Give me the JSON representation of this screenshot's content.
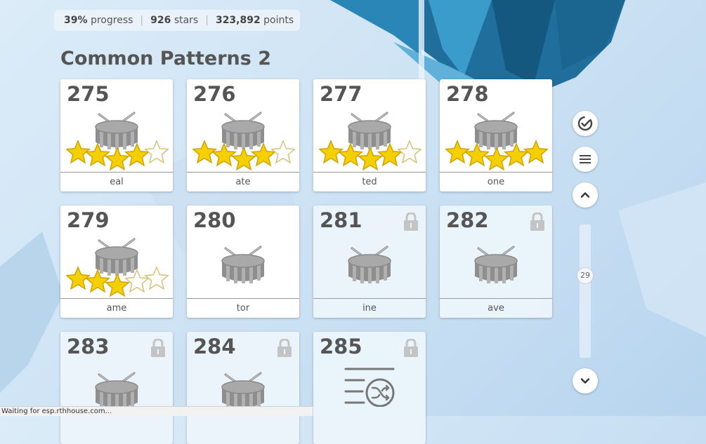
{
  "stats": {
    "progress_value": "39%",
    "progress_label": "progress",
    "stars_value": "926",
    "stars_label": "stars",
    "points_value": "323,892",
    "points_label": "points"
  },
  "section_title": "Common Patterns 2",
  "levels": [
    {
      "number": "275",
      "label": "eal",
      "stars": 4,
      "locked": false
    },
    {
      "number": "276",
      "label": "ate",
      "stars": 4,
      "locked": false
    },
    {
      "number": "277",
      "label": "ted",
      "stars": 4,
      "locked": false
    },
    {
      "number": "278",
      "label": "one",
      "stars": 5,
      "locked": false
    },
    {
      "number": "279",
      "label": "ame",
      "stars": 3,
      "locked": false
    },
    {
      "number": "280",
      "label": "tor",
      "stars": 0,
      "locked": false
    },
    {
      "number": "281",
      "label": "ine",
      "stars": 0,
      "locked": true
    },
    {
      "number": "282",
      "label": "ave",
      "stars": 0,
      "locked": true
    },
    {
      "number": "283",
      "label": "",
      "stars": 0,
      "locked": true
    },
    {
      "number": "284",
      "label": "",
      "stars": 0,
      "locked": true
    },
    {
      "number": "285",
      "label": "",
      "stars": 0,
      "locked": true,
      "icon": "shuffle-list-icon"
    }
  ],
  "sidebar": {
    "check_icon": "check-circle-icon",
    "menu_icon": "menu-icon",
    "up_icon": "chevron-up-icon",
    "down_icon": "chevron-down-icon",
    "scroll_value": "29"
  },
  "status_text": "Waiting for esp.rthhouse.com...",
  "colors": {
    "star_fill": "#f5d000",
    "drum": "#9a9a9a",
    "lock": "#c4c4c4"
  }
}
